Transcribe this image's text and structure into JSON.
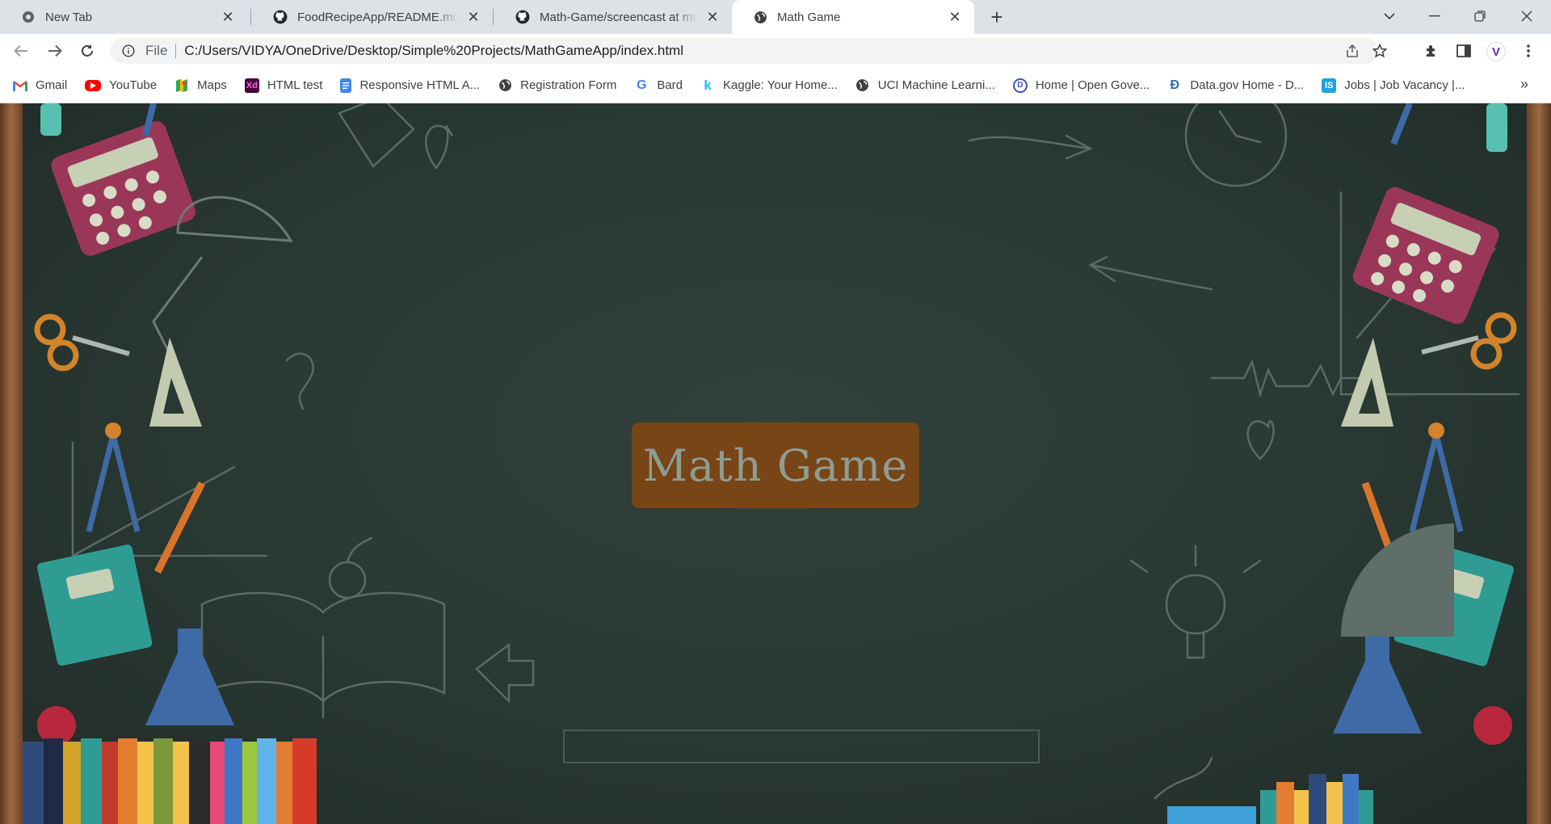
{
  "tabs": [
    {
      "title": "New Tab",
      "icon": "chrome-icon"
    },
    {
      "title": "FoodRecipeApp/README.md at",
      "icon": "github-icon"
    },
    {
      "title": "Math-Game/screencast at main ·",
      "icon": "github-icon"
    },
    {
      "title": "Math Game",
      "icon": "globe-icon",
      "active": true
    }
  ],
  "address_bar": {
    "scheme_label": "File",
    "url": "C:/Users/VIDYA/OneDrive/Desktop/Simple%20Projects/MathGameApp/index.html"
  },
  "profile_initial": "V",
  "bookmarks": [
    {
      "label": "Gmail",
      "icon": "gmail-icon"
    },
    {
      "label": "YouTube",
      "icon": "youtube-icon"
    },
    {
      "label": "Maps",
      "icon": "maps-icon"
    },
    {
      "label": "HTML test",
      "icon": "xd-icon"
    },
    {
      "label": "Responsive HTML A...",
      "icon": "docs-icon"
    },
    {
      "label": "Registration Form",
      "icon": "globe-icon"
    },
    {
      "label": "Bard",
      "icon": "google-icon"
    },
    {
      "label": "Kaggle: Your Home...",
      "icon": "kaggle-icon"
    },
    {
      "label": "UCI Machine Learni...",
      "icon": "globe-icon"
    },
    {
      "label": "Home | Open Gove...",
      "icon": "open-gov-icon"
    },
    {
      "label": "Data.gov Home - D...",
      "icon": "datagov-icon"
    },
    {
      "label": "Jobs | Job Vacancy |...",
      "icon": "jobs-icon"
    }
  ],
  "page": {
    "heading": "Math Game",
    "answer_value": ""
  },
  "colors": {
    "board": "#2a3833",
    "heading_bg": "#784516",
    "heading_text": "#8e9d94"
  }
}
